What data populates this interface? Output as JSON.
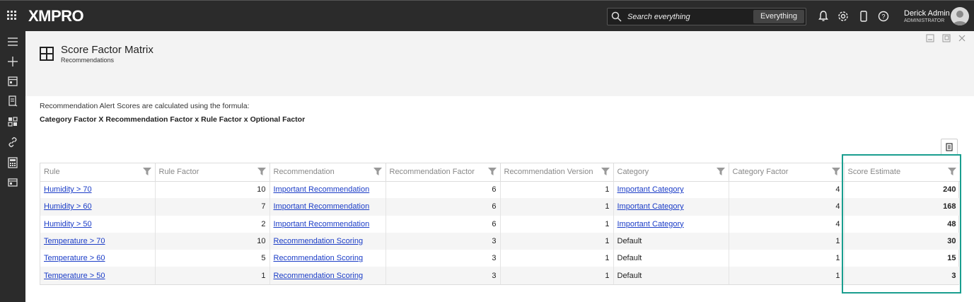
{
  "app": {
    "logo": "XMPRO"
  },
  "search": {
    "placeholder": "Search everything",
    "scope": "Everything"
  },
  "user": {
    "name": "Derick Admin",
    "role": "ADMINISTRATOR"
  },
  "page": {
    "title": "Score Factor Matrix",
    "subtitle": "Recommendations"
  },
  "formula": {
    "intro": "Recommendation Alert Scores are calculated using the formula:",
    "expression": "Category Factor X Recommendation Factor x Rule Factor x Optional Factor"
  },
  "table": {
    "columns": [
      "Rule",
      "Rule Factor",
      "Recommendation",
      "Recommendation Factor",
      "Recommendation Version",
      "Category",
      "Category Factor",
      "Score Estimate"
    ],
    "rows": [
      {
        "rule": "Humidity > 70",
        "rule_factor": "10",
        "recommendation": "Important Recommendation",
        "rec_factor": "6",
        "rec_version": "1",
        "category": "Important Category",
        "cat_factor": "4",
        "score": "240"
      },
      {
        "rule": "Humidity > 60",
        "rule_factor": "7",
        "recommendation": "Important Recommendation",
        "rec_factor": "6",
        "rec_version": "1",
        "category": "Important Category",
        "cat_factor": "4",
        "score": "168"
      },
      {
        "rule": "Humidity > 50",
        "rule_factor": "2",
        "recommendation": "Important Recommendation",
        "rec_factor": "6",
        "rec_version": "1",
        "category": "Important Category",
        "cat_factor": "4",
        "score": "48"
      },
      {
        "rule": "Temperature > 70",
        "rule_factor": "10",
        "recommendation": "Recommendation Scoring",
        "rec_factor": "3",
        "rec_version": "1",
        "category": "Default",
        "cat_factor": "1",
        "score": "30"
      },
      {
        "rule": "Temperature > 60",
        "rule_factor": "5",
        "recommendation": "Recommendation Scoring",
        "rec_factor": "3",
        "rec_version": "1",
        "category": "Default",
        "cat_factor": "1",
        "score": "15"
      },
      {
        "rule": "Temperature > 50",
        "rule_factor": "1",
        "recommendation": "Recommendation Scoring",
        "rec_factor": "3",
        "rec_version": "1",
        "category": "Default",
        "cat_factor": "1",
        "score": "3"
      }
    ]
  },
  "colors": {
    "topbar": "#2b2b2b",
    "link": "#1a3cc7",
    "highlight": "#1a9e8f"
  },
  "icons": [
    "apps-grid-icon",
    "search-icon",
    "bell-icon",
    "gear-icon",
    "mobile-icon",
    "help-icon",
    "menu-icon",
    "plus-icon",
    "filter-icon",
    "export-icon"
  ]
}
